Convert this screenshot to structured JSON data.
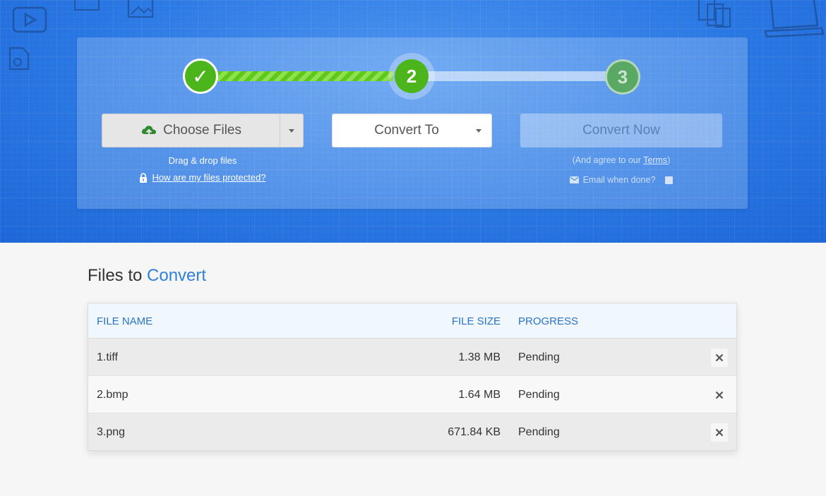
{
  "steps": [
    {
      "label": "✓",
      "state": "done"
    },
    {
      "label": "2",
      "state": "active"
    },
    {
      "label": "3",
      "state": "pending"
    }
  ],
  "choose_files": {
    "label": "Choose Files",
    "icon": "cloud-upload-icon"
  },
  "convert_to": {
    "label": "Convert To"
  },
  "convert_now": {
    "label": "Convert Now"
  },
  "drag_drop": "Drag & drop files",
  "protected_link": "How are my files protected?",
  "agree": {
    "prefix": "(And agree to our ",
    "link": "Terms",
    "suffix": ")"
  },
  "email_when_done": "Email when done?",
  "section": {
    "title_prefix": "Files to ",
    "title_accent": "Convert"
  },
  "table": {
    "headers": {
      "file_name": "FILE NAME",
      "file_size": "FILE SIZE",
      "progress": "PROGRESS"
    },
    "rows": [
      {
        "name": "1.tiff",
        "size": "1.38 MB",
        "progress": "Pending"
      },
      {
        "name": "2.bmp",
        "size": "1.64 MB",
        "progress": "Pending"
      },
      {
        "name": "3.png",
        "size": "671.84 KB",
        "progress": "Pending"
      }
    ]
  },
  "colors": {
    "hero_blue": "#2f7fe8",
    "step_green": "#4cb51c",
    "accent": "#2f80d6",
    "header_text": "#2b72c6"
  }
}
